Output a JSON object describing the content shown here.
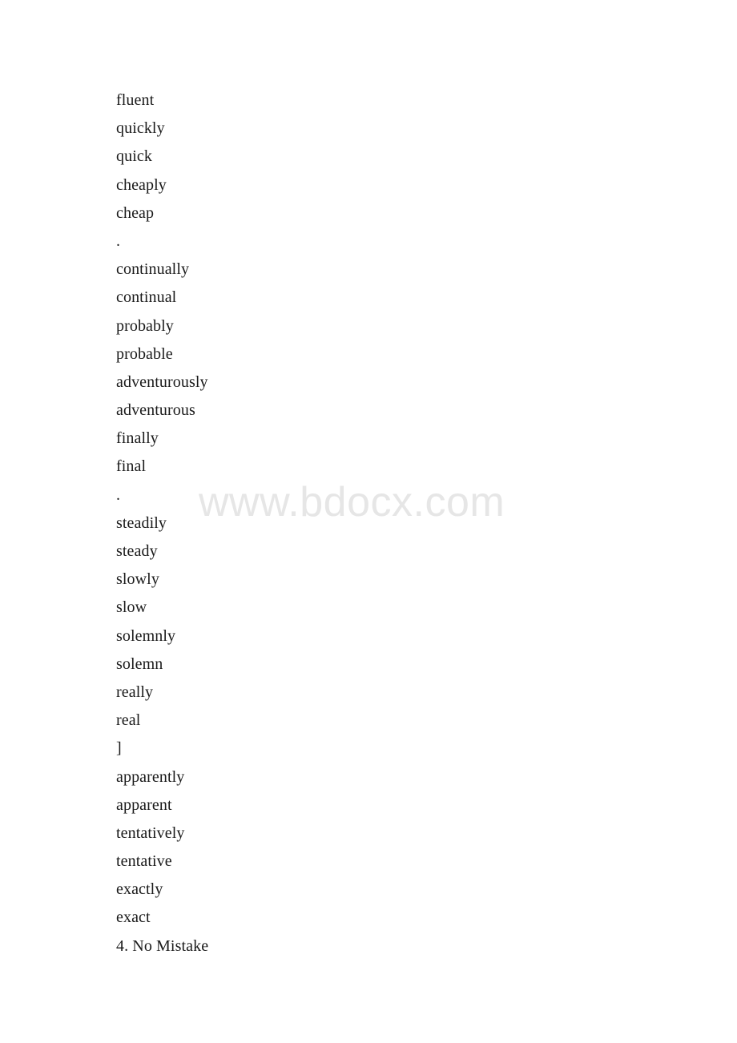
{
  "document": {
    "watermark": "www.bdocx.com",
    "lines": [
      {
        "text": "fluent",
        "kind": "word"
      },
      {
        "text": "quickly",
        "kind": "word"
      },
      {
        "text": "quick",
        "kind": "word"
      },
      {
        "text": "cheaply",
        "kind": "word"
      },
      {
        "text": "cheap",
        "kind": "word"
      },
      {
        "text": ".",
        "kind": "separator"
      },
      {
        "text": "continually",
        "kind": "word"
      },
      {
        "text": "continual",
        "kind": "word"
      },
      {
        "text": "probably",
        "kind": "word"
      },
      {
        "text": "probable",
        "kind": "word"
      },
      {
        "text": "adventurously",
        "kind": "word"
      },
      {
        "text": "adventurous",
        "kind": "word"
      },
      {
        "text": "finally",
        "kind": "word"
      },
      {
        "text": "final",
        "kind": "word"
      },
      {
        "text": ".",
        "kind": "separator"
      },
      {
        "text": "steadily",
        "kind": "word"
      },
      {
        "text": "steady",
        "kind": "word"
      },
      {
        "text": "slowly",
        "kind": "word"
      },
      {
        "text": "slow",
        "kind": "word"
      },
      {
        "text": "solemnly",
        "kind": "word"
      },
      {
        "text": "solemn",
        "kind": "word"
      },
      {
        "text": "really",
        "kind": "word"
      },
      {
        "text": "real",
        "kind": "word"
      },
      {
        "text": "]",
        "kind": "separator"
      },
      {
        "text": "apparently",
        "kind": "word"
      },
      {
        "text": "apparent",
        "kind": "word"
      },
      {
        "text": "tentatively",
        "kind": "word"
      },
      {
        "text": "tentative",
        "kind": "word"
      },
      {
        "text": "exactly",
        "kind": "word"
      },
      {
        "text": "exact",
        "kind": "word"
      },
      {
        "text": "4. No Mistake",
        "kind": "numbered-item"
      }
    ]
  },
  "colors": {
    "text": "#1a1a1a",
    "watermark": "#e6e6e6",
    "background": "#ffffff"
  }
}
